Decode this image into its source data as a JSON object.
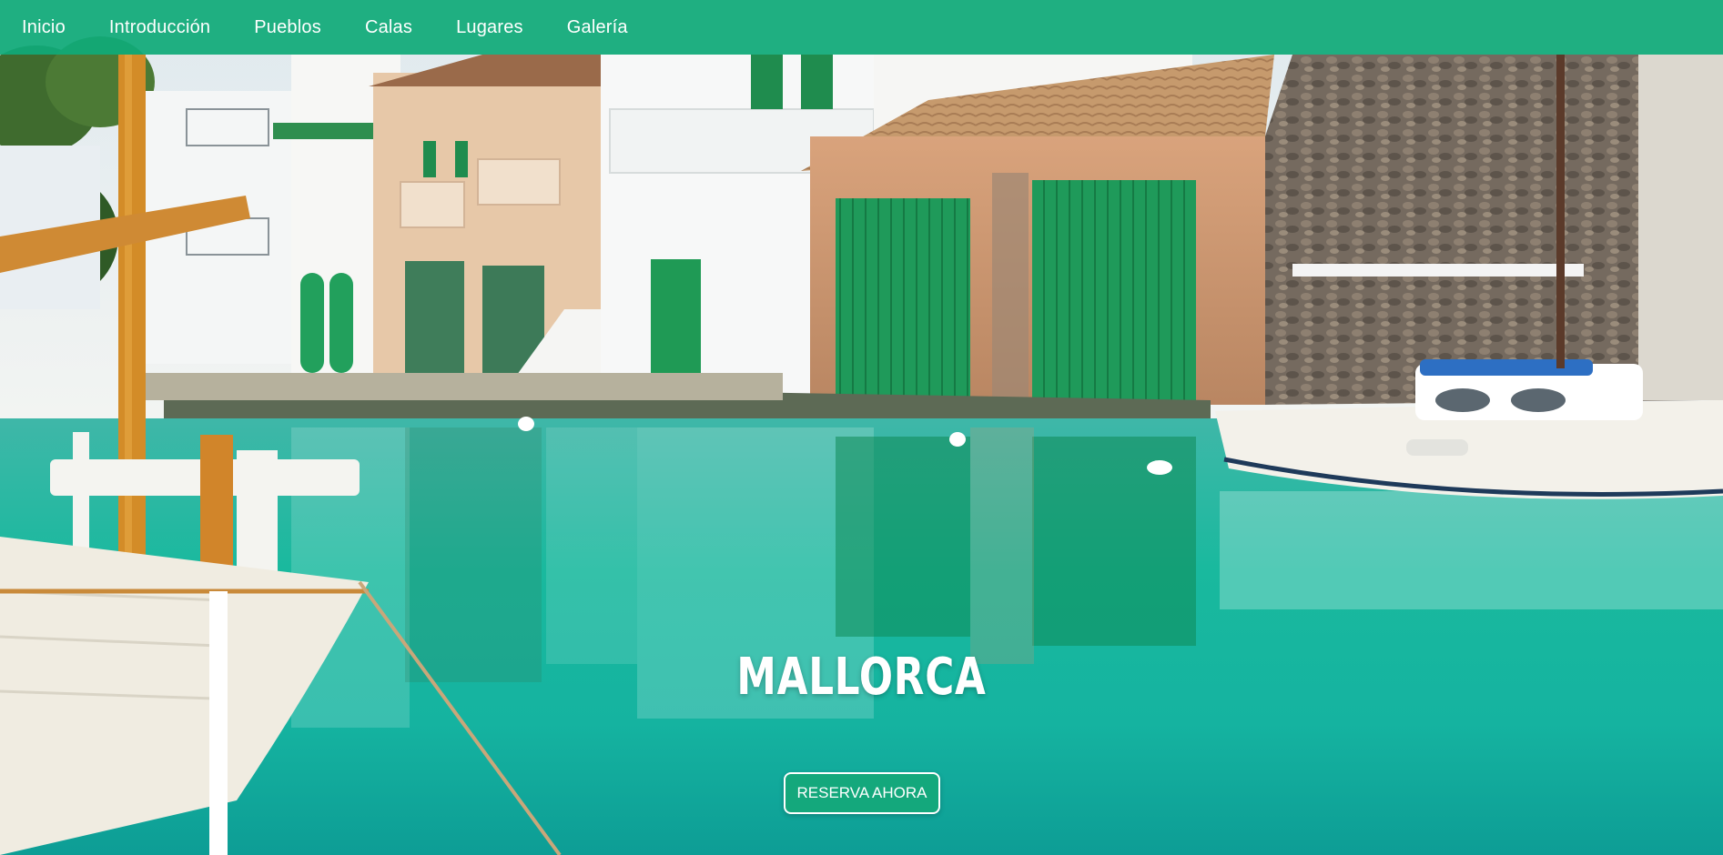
{
  "nav": {
    "items": [
      {
        "label": "Inicio"
      },
      {
        "label": "Introducción"
      },
      {
        "label": "Pueblos"
      },
      {
        "label": "Calas"
      },
      {
        "label": "Lugares"
      },
      {
        "label": "Galería"
      }
    ]
  },
  "hero": {
    "title": "MALLORCA",
    "cta_label": "RESERVA AHORA",
    "image": "harbour-with-boats-and-green-doored-houses"
  },
  "colors": {
    "navbar": "#10aa78",
    "cta_background": "#14a87c",
    "text": "#ffffff",
    "water": "#12b3a0"
  }
}
